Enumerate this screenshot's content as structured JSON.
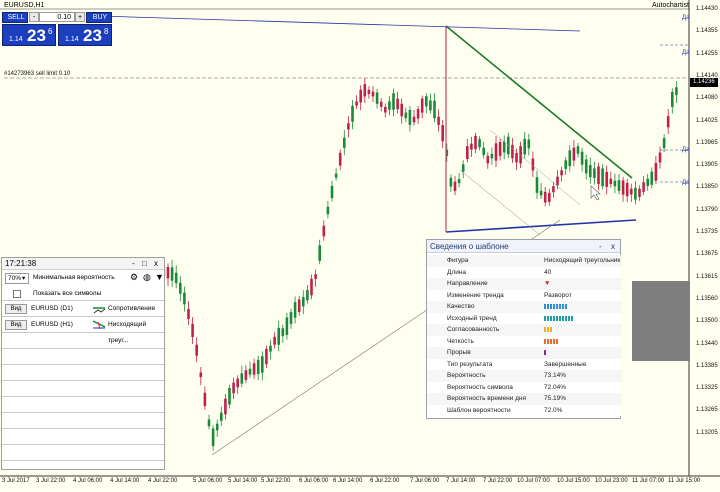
{
  "window": {
    "symbol": "EURUSD,H1",
    "autochartist": "Autochartist",
    "order_line": "#14273963 sell limit 0.10"
  },
  "trade_panel": {
    "sell_label": "SELL",
    "buy_label": "BUY",
    "volume": "0.10",
    "sell_price_prefix": "1.14",
    "sell_price_big": "23",
    "sell_price_sup": "6",
    "buy_price_prefix": "1.14",
    "buy_price_big": "23",
    "buy_price_sup": "8"
  },
  "price_scale": [
    "1.14430",
    "1.14355",
    "1.14255",
    "1.14140",
    "1.14080",
    "1.14025",
    "1.13965",
    "1.13905",
    "1.13850",
    "1.13790",
    "1.13735",
    "1.13675",
    "1.13615",
    "1.13560",
    "1.13500",
    "1.13440",
    "1.13385",
    "1.13325",
    "1.13265",
    "1.13205"
  ],
  "current_price": "1.14236",
  "time_scale": [
    "3 Jul 2017",
    "3 Jul 22:00",
    "4 Jul 06:00",
    "4 Jul 14:00",
    "4 Jul 22:00",
    "5 Jul 06:00",
    "5 Jul 14:00",
    "5 Jul 22:00",
    "6 Jul 06:00",
    "6 Jul 14:00",
    "6 Jul 22:00",
    "7 Jul 06:00",
    "7 Jul 14:00",
    "7 Jul 22:00",
    "10 Jul 07:00",
    "10 Jul 15:00",
    "10 Jul 23:00",
    "11 Jul 07:00",
    "11 Jul 15:00"
  ],
  "right_markers": [
    "Да",
    "Да",
    "Да",
    "Да"
  ],
  "left_panel": {
    "time": "17:21:38",
    "probability_value": "70%",
    "probability_label": "Минимальная вероятность",
    "show_all_label": "Показать все символы",
    "rows": [
      {
        "view": "Вид",
        "symbol": "EURUSD (D1)",
        "pattern": "Сопротивление"
      },
      {
        "view": "Вид",
        "symbol": "EURUSD (H1)",
        "pattern": "Нисходящий треуг..."
      }
    ],
    "controls": [
      "-",
      "□",
      "x"
    ]
  },
  "info_panel": {
    "title": "Сведения о шаблоне",
    "controls": [
      "-",
      "x"
    ],
    "rows": [
      {
        "label": "Фигура",
        "value": "Нисходящий треугольник"
      },
      {
        "label": "Длина",
        "value": "40"
      },
      {
        "label": "Направление",
        "value": "▼"
      },
      {
        "label": "Изменение тренда",
        "value": "Разворот"
      },
      {
        "label": "Качество",
        "value": "",
        "bars": 8,
        "color": "#2a8fd6"
      },
      {
        "label": "Исходный тренд",
        "value": "",
        "bars": 10,
        "color": "#1a9fa5"
      },
      {
        "label": "Согласованность",
        "value": "",
        "bars": 3,
        "color": "#f0b020"
      },
      {
        "label": "Четкость",
        "value": "",
        "bars": 5,
        "color": "#e86a2a"
      },
      {
        "label": "Прорыв",
        "value": "",
        "bars": 1,
        "color": "#8a2a9a"
      },
      {
        "label": "Тип результата",
        "value": "Завершенные"
      },
      {
        "label": "Вероятность",
        "value": "73.14%"
      },
      {
        "label": "Вероятность символа",
        "value": "72.04%"
      },
      {
        "label": "Вероятность времени дня",
        "value": "75.19%"
      },
      {
        "label": "Шаблон вероятности",
        "value": "72.0%"
      }
    ]
  }
}
